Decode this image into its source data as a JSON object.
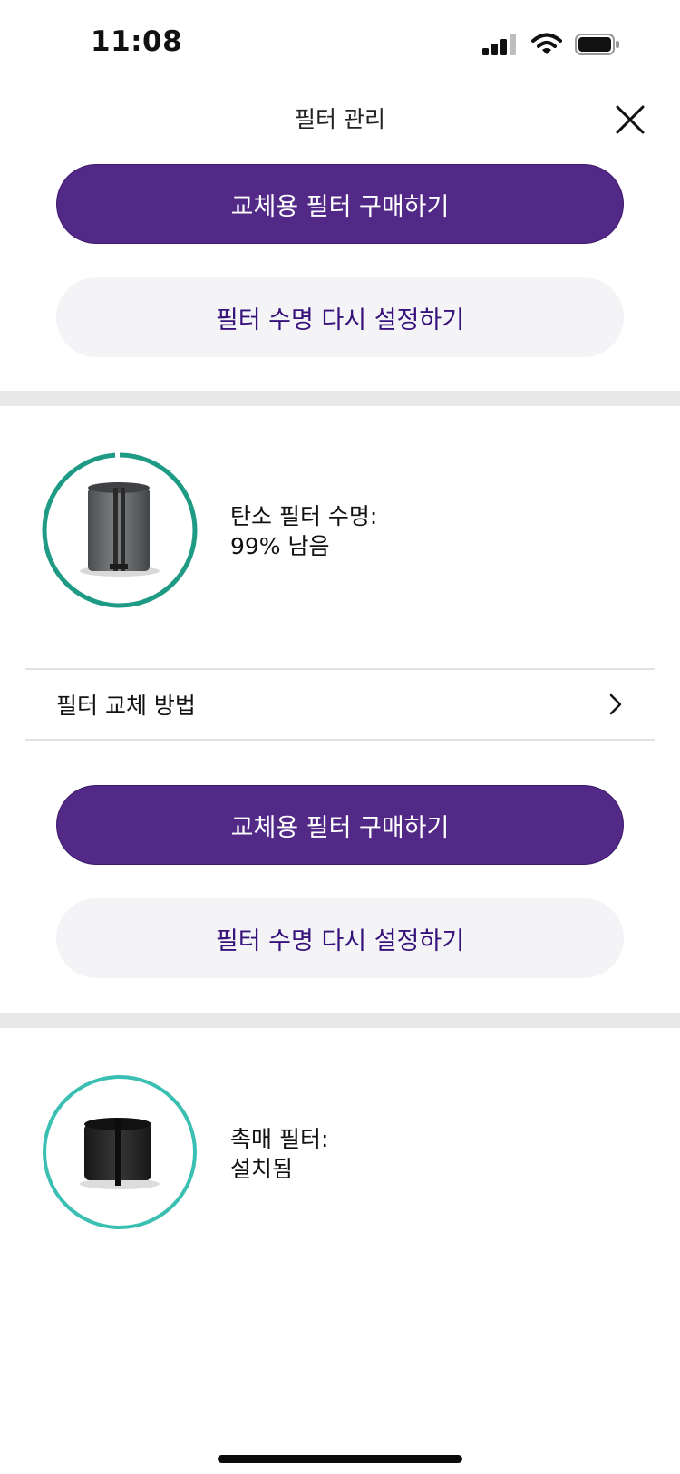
{
  "status_bar": {
    "time": "11:08",
    "icons": [
      "signal-icon",
      "wifi-icon",
      "battery-icon"
    ]
  },
  "header": {
    "title": "필터 관리",
    "close_icon": "close-icon"
  },
  "top_actions": {
    "buy_label": "교체용 필터 구매하기",
    "reset_label": "필터 수명 다시 설정하기"
  },
  "carbon_filter": {
    "title": "탄소 필터 수명:",
    "status": "99% 남음",
    "life_remaining_percent": 99,
    "ring_color": "#1e9a85",
    "replace_link_label": "필터 교체 방법",
    "buy_label": "교체용 필터 구매하기",
    "reset_label": "필터 수명 다시 설정하기"
  },
  "catalyst_filter": {
    "title": "촉매 필터:",
    "status": "설치됨",
    "ring_color": "#3bbfb3"
  },
  "colors": {
    "primary": "#522987",
    "secondary_bg": "#f4f4f6",
    "secondary_text": "#36127a"
  }
}
